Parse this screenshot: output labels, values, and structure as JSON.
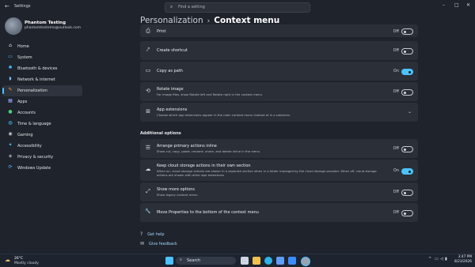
{
  "window": {
    "back_icon": "arrow-left-icon",
    "title": "Settings",
    "search_placeholder": "Find a setting",
    "controls": {
      "minimize": "–",
      "maximize": "□",
      "close": "✕"
    }
  },
  "profile": {
    "name": "Phantom Testing",
    "email": "phantomtestemo@outlook.com"
  },
  "nav": {
    "items": [
      {
        "label": "Home",
        "icon": "home-icon",
        "glyph": "⌂",
        "color": "#e8e8e8",
        "active": false
      },
      {
        "label": "System",
        "icon": "system-icon",
        "glyph": "▭",
        "color": "#4cc2ff",
        "active": false
      },
      {
        "label": "Bluetooth & devices",
        "icon": "bluetooth-icon",
        "glyph": "✱",
        "color": "#4cc2ff",
        "active": false
      },
      {
        "label": "Network & internet",
        "icon": "wifi-icon",
        "glyph": "◗",
        "color": "#7ec4ff",
        "active": false
      },
      {
        "label": "Personalization",
        "icon": "brush-icon",
        "glyph": "✎",
        "color": "#f0a040",
        "active": true
      },
      {
        "label": "Apps",
        "icon": "apps-icon",
        "glyph": "▦",
        "color": "#9aa8ff",
        "active": false
      },
      {
        "label": "Accounts",
        "icon": "account-icon",
        "glyph": "●",
        "color": "#4cd07d",
        "active": false
      },
      {
        "label": "Time & language",
        "icon": "globe-icon",
        "glyph": "◍",
        "color": "#4cc2ff",
        "active": false
      },
      {
        "label": "Gaming",
        "icon": "gaming-icon",
        "glyph": "◉",
        "color": "#c8c8c8",
        "active": false
      },
      {
        "label": "Accessibility",
        "icon": "accessibility-icon",
        "glyph": "✦",
        "color": "#59b7ff",
        "active": false
      },
      {
        "label": "Privacy & security",
        "icon": "shield-icon",
        "glyph": "◈",
        "color": "#a8b0bc",
        "active": false
      },
      {
        "label": "Windows Update",
        "icon": "update-icon",
        "glyph": "⟳",
        "color": "#4cc2ff",
        "active": false
      }
    ]
  },
  "breadcrumb": {
    "parent": "Personalization",
    "separator": "›",
    "current": "Context menu"
  },
  "settings": {
    "print": {
      "title": "Print",
      "state": "Off",
      "on": false,
      "icon": "printer-icon",
      "glyph": "⎙"
    },
    "create_shortcut": {
      "title": "Create shortcut",
      "state": "Off",
      "on": false,
      "icon": "shortcut-icon",
      "glyph": "⤤"
    },
    "copy_as_path": {
      "title": "Copy as path",
      "state": "On",
      "on": true,
      "icon": "copy-path-icon",
      "glyph": "▭"
    },
    "rotate_image": {
      "title": "Rotate image",
      "desc": "For image files, show Rotate left and Rotate right in the context menu",
      "state": "Off",
      "on": false,
      "icon": "rotate-icon",
      "glyph": "⟲"
    },
    "app_extensions": {
      "title": "App extensions",
      "desc": "Choose which app extensions appear in the main context menu instead of in a submenu",
      "icon": "extensions-icon",
      "glyph": "⊞",
      "chevron": "⌄"
    }
  },
  "additional": {
    "heading": "Additional options",
    "arrange_primary": {
      "title": "Arrange primary actions inline",
      "desc": "Show cut, copy, paste, rename, share, and delete inline in the menu",
      "state": "Off",
      "on": false,
      "icon": "arrange-icon",
      "glyph": "☰"
    },
    "cloud_storage": {
      "title": "Keep cloud storage actions in their own section",
      "desc_line1": "When on, cloud storage actions are shown in a separate section when in a folder managed by the cloud storage provider. When off, cloud storage",
      "desc_line2": "actions are shown with other app extensions",
      "state": "On",
      "on": true,
      "icon": "cloud-icon",
      "glyph": "☁"
    },
    "show_more": {
      "title": "Show more options",
      "desc": "Show legacy context menu",
      "state": "Off",
      "on": false,
      "icon": "more-options-icon",
      "glyph": "⤢"
    },
    "move_properties": {
      "title": "Move Properties to the bottom of the context menu",
      "state": "Off",
      "on": false,
      "icon": "wrench-icon",
      "glyph": "🔧"
    }
  },
  "links": {
    "help": {
      "label": "Get help",
      "icon": "help-icon",
      "glyph": "?"
    },
    "feedback": {
      "label": "Give feedback",
      "icon": "feedback-icon",
      "glyph": "✉"
    }
  },
  "taskbar": {
    "weather": {
      "temp": "26°C",
      "condition": "Mostly cloudy",
      "icon": "weather-cloud-sun-icon"
    },
    "search_label": "Search",
    "apps": [
      {
        "name": "start-button",
        "color": "#4cc2ff"
      },
      {
        "name": "task-view-icon",
        "color": "#d0d6e0"
      },
      {
        "name": "file-explorer-icon",
        "color": "#f2c14e"
      },
      {
        "name": "edge-icon",
        "color": "#2fb2e6"
      },
      {
        "name": "store-icon",
        "color": "#5e9dff"
      },
      {
        "name": "mail-icon",
        "color": "#3a8cff"
      },
      {
        "name": "settings-icon",
        "color": "#9aa3b0"
      }
    ],
    "tray": {
      "chevron": "^",
      "network": "▭",
      "volume": "◁",
      "battery": "▮"
    },
    "time": "3:47 PM",
    "date": "8/23/2026"
  }
}
